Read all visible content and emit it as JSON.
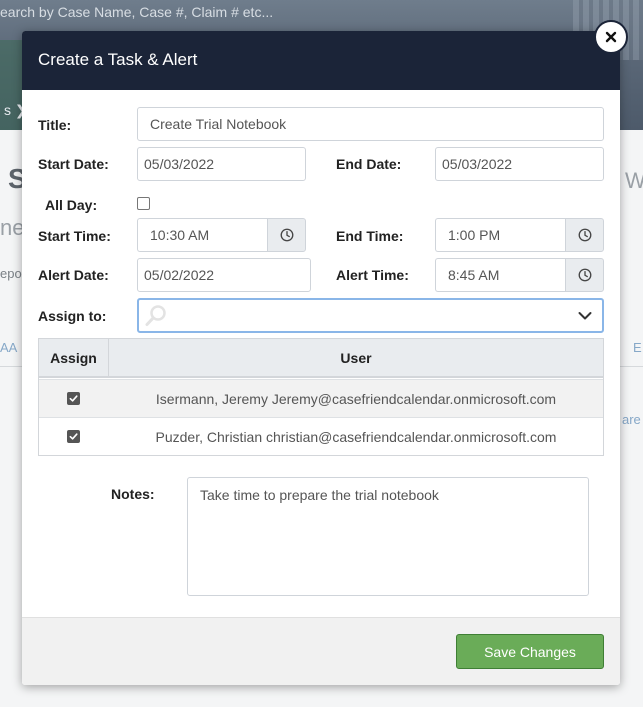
{
  "background": {
    "search_placeholder": "earch by Case Name, Case #, Claim # etc...",
    "fragment_s": "S",
    "fragment_w": "W",
    "fragment_ne": "ne",
    "fragment_epo": "epo",
    "fragment_aa": "AA",
    "fragment_e": "E",
    "fragment_are": "are",
    "nav_chevron": "s ❯"
  },
  "modal": {
    "title": "Create a Task & Alert",
    "close_icon": "close-icon",
    "form": {
      "title_label": "Title:",
      "title_value": "Create Trial Notebook",
      "start_date_label": "Start Date:",
      "start_date_value": "05/03/2022",
      "end_date_label": "End Date:",
      "end_date_value": "05/03/2022",
      "all_day_label": "All Day:",
      "all_day_checked": false,
      "start_time_label": "Start Time:",
      "start_time_value": "10:30 AM",
      "end_time_label": "End Time:",
      "end_time_value": "1:00 PM",
      "alert_date_label": "Alert Date:",
      "alert_date_value": "05/02/2022",
      "alert_time_label": "Alert Time:",
      "alert_time_value": "8:45 AM",
      "assign_to_label": "Assign to:",
      "assign_to_value": ""
    },
    "assign_table": {
      "columns": [
        "Assign",
        "User"
      ],
      "rows": [
        {
          "checked": true,
          "user": "Isermann, Jeremy Jeremy@casefriendcalendar.onmicrosoft.com"
        },
        {
          "checked": true,
          "user": "Puzder, Christian christian@casefriendcalendar.onmicrosoft.com"
        }
      ]
    },
    "notes_label": "Notes:",
    "notes_value": "Take time to prepare the trial notebook",
    "save_label": "Save Changes"
  },
  "colors": {
    "header_bg": "#1b2438",
    "save_button": "#6aac58",
    "focus_border": "#8ab6e8"
  }
}
